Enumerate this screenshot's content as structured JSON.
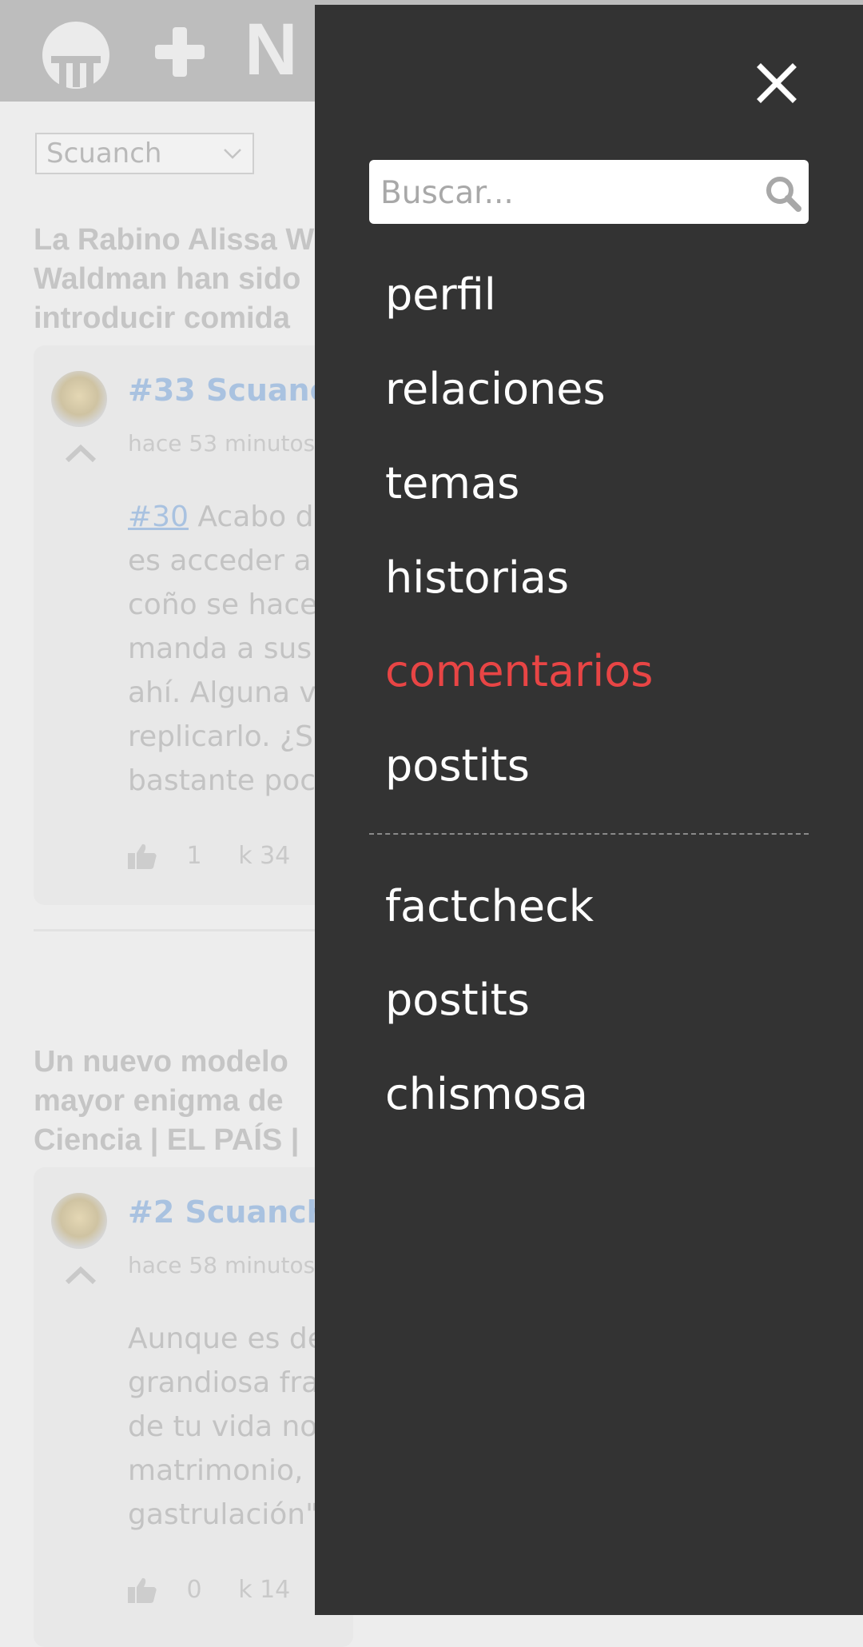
{
  "header": {
    "brand_letter": "N"
  },
  "filter": {
    "selected": "Scuanch"
  },
  "stories": [
    {
      "title_lines": [
        "La Rabino Alissa W",
        "Waldman han sido",
        "introducir comida"
      ],
      "comment": {
        "user": "#33 Scuanc",
        "time": "hace 53 minutos",
        "ref": "#30",
        "lines": [
          " Acabo de",
          "es acceder a",
          "coño se hace",
          "manda a sus",
          "ahí. Alguna ve",
          "replicarlo. ¿Sa",
          "bastante poc"
        ],
        "votes": "1",
        "karma": "k 34"
      }
    },
    {
      "title_lines": [
        "Un nuevo modelo",
        "mayor enigma de",
        "Ciencia | EL PAÍS |"
      ],
      "comment": {
        "user": "#2 Scuanch",
        "time": "hace 58 minutos",
        "lines": [
          "Aunque es de",
          "grandiosa fra",
          "de tu vida no",
          "matrimonio,",
          "gastrulación\""
        ],
        "votes": "0",
        "karma": "k 14"
      }
    }
  ],
  "drawer": {
    "search_placeholder": "Buscar...",
    "primary_items": [
      "perfil",
      "relaciones",
      "temas",
      "historias",
      "comentarios",
      "postits"
    ],
    "active_item": "comentarios",
    "secondary_items": [
      "factcheck",
      "postits",
      "chismosa"
    ]
  },
  "colors": {
    "drawer_bg": "#333333",
    "active_item": "#e84545",
    "menu_text": "#ffffff"
  },
  "icons": [
    "menéame-logo-icon",
    "plus-icon",
    "close-icon",
    "search-icon",
    "chevron-down-icon",
    "chevron-up-icon",
    "thumbs-up-icon"
  ]
}
